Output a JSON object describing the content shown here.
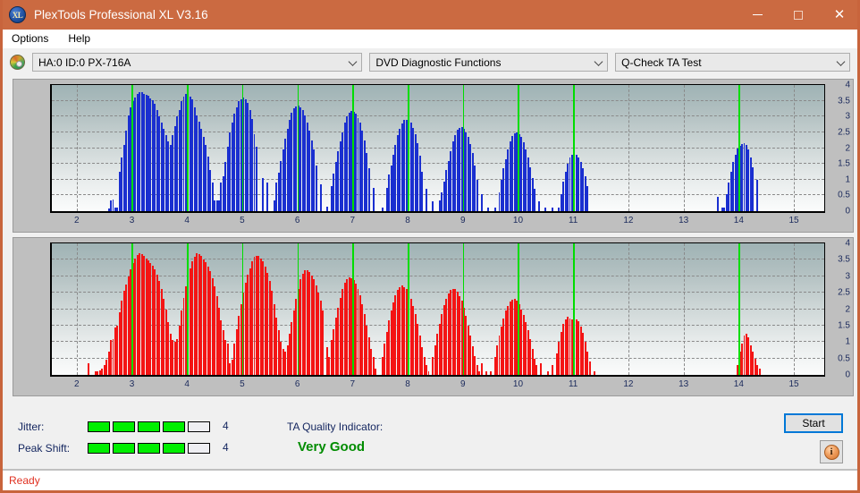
{
  "window": {
    "title": "PlexTools Professional XL V3.16",
    "app_icon": "XL",
    "minimize_label": "minimize",
    "maximize_label": "maximize",
    "close_label": "close"
  },
  "menubar": {
    "items": [
      {
        "label": "Options"
      },
      {
        "label": "Help"
      }
    ]
  },
  "toolbar": {
    "drive_icon": "disc-icon",
    "drive_select": "HA:0 ID:0  PX-716A",
    "function_select": "DVD Diagnostic Functions",
    "test_select": "Q-Check TA Test"
  },
  "stats": {
    "jitter_label": "Jitter:",
    "jitter_value": "4",
    "jitter_filled": 4,
    "jitter_total": 5,
    "peak_shift_label": "Peak Shift:",
    "peak_shift_value": "4",
    "peak_shift_filled": 4,
    "peak_shift_total": 5,
    "tqi_label": "TA Quality Indicator:",
    "tqi_value": "Very Good",
    "tqi_color": "#008c00",
    "start_label": "Start",
    "info_label": "i"
  },
  "statusbar": {
    "text": "Ready"
  },
  "colors": {
    "titlebar": "#cb6a41",
    "jitter_bar": "#00ef00",
    "marker_line": "#00dd00",
    "top_series": "#1a2fd0",
    "bottom_series": "#f41414",
    "status_text": "#e03020"
  },
  "chart_data": [
    {
      "type": "bar",
      "name": "jitter-histogram",
      "title": "",
      "xlabel": "",
      "ylabel": "",
      "color": "#1a2fd0",
      "xlim": [
        1.55,
        15.55
      ],
      "ylim": [
        0,
        4
      ],
      "yticks": [
        0,
        0.5,
        1,
        1.5,
        2,
        2.5,
        3,
        3.5,
        4
      ],
      "xticks": [
        2,
        3,
        4,
        5,
        6,
        7,
        8,
        9,
        10,
        11,
        12,
        13,
        14,
        15
      ],
      "grid": true,
      "markers": [
        3,
        4,
        5,
        6,
        7,
        8,
        9,
        10,
        11,
        14
      ],
      "x": [
        2.58,
        2.62,
        2.66,
        2.7,
        2.74,
        2.78,
        2.82,
        2.86,
        2.9,
        2.94,
        2.98,
        3.02,
        3.06,
        3.1,
        3.14,
        3.18,
        3.22,
        3.26,
        3.3,
        3.34,
        3.38,
        3.42,
        3.46,
        3.5,
        3.54,
        3.58,
        3.62,
        3.66,
        3.7,
        3.74,
        3.78,
        3.82,
        3.86,
        3.9,
        3.94,
        3.98,
        4.02,
        4.06,
        4.1,
        4.14,
        4.18,
        4.22,
        4.26,
        4.3,
        4.34,
        4.38,
        4.42,
        4.46,
        4.5,
        4.54,
        4.58,
        4.62,
        4.66,
        4.7,
        4.74,
        4.78,
        4.82,
        4.86,
        4.9,
        4.94,
        4.98,
        5.02,
        5.06,
        5.1,
        5.14,
        5.18,
        5.22,
        5.26,
        5.38,
        5.46,
        5.58,
        5.62,
        5.66,
        5.7,
        5.74,
        5.78,
        5.82,
        5.86,
        5.9,
        5.94,
        5.98,
        6.02,
        6.06,
        6.1,
        6.14,
        6.18,
        6.22,
        6.26,
        6.3,
        6.34,
        6.42,
        6.54,
        6.62,
        6.66,
        6.7,
        6.74,
        6.78,
        6.82,
        6.86,
        6.9,
        6.94,
        6.98,
        7.02,
        7.06,
        7.1,
        7.14,
        7.18,
        7.22,
        7.26,
        7.3,
        7.38,
        7.54,
        7.62,
        7.66,
        7.7,
        7.74,
        7.78,
        7.82,
        7.86,
        7.9,
        7.94,
        7.98,
        8.02,
        8.06,
        8.1,
        8.14,
        8.18,
        8.22,
        8.26,
        8.34,
        8.46,
        8.58,
        8.62,
        8.66,
        8.7,
        8.74,
        8.78,
        8.82,
        8.86,
        8.9,
        8.94,
        8.98,
        9.02,
        9.06,
        9.1,
        9.14,
        9.18,
        9.22,
        9.26,
        9.34,
        9.46,
        9.58,
        9.66,
        9.7,
        9.74,
        9.78,
        9.82,
        9.86,
        9.9,
        9.94,
        9.98,
        10.02,
        10.06,
        10.1,
        10.14,
        10.18,
        10.22,
        10.26,
        10.3,
        10.38,
        10.5,
        10.62,
        10.74,
        10.78,
        10.82,
        10.86,
        10.9,
        10.94,
        10.98,
        11.02,
        11.06,
        11.1,
        11.14,
        11.18,
        11.22,
        11.26,
        13.62,
        13.7,
        13.74,
        13.78,
        13.82,
        13.86,
        13.9,
        13.94,
        13.98,
        14.02,
        14.06,
        14.1,
        14.14,
        14.18,
        14.22,
        14.26,
        14.34
      ],
      "values": [
        0.08,
        0.35,
        0.36,
        0.1,
        0.1,
        1.25,
        1.7,
        2.1,
        2.55,
        3.05,
        3.3,
        3.48,
        3.6,
        3.72,
        3.78,
        3.78,
        3.72,
        3.7,
        3.65,
        3.58,
        3.52,
        3.4,
        3.22,
        3.0,
        2.8,
        2.62,
        2.4,
        2.2,
        2.1,
        2.42,
        2.7,
        3.0,
        3.2,
        3.48,
        3.62,
        3.72,
        3.7,
        3.62,
        3.55,
        3.3,
        3.05,
        2.85,
        2.6,
        2.35,
        2.1,
        1.72,
        1.3,
        0.92,
        0.33,
        0.33,
        0.35,
        0.9,
        1.1,
        1.55,
        2.05,
        2.5,
        2.8,
        3.1,
        3.3,
        3.48,
        3.55,
        3.6,
        3.56,
        3.42,
        3.2,
        2.92,
        2.45,
        2.05,
        1.05,
        0.9,
        0.33,
        0.9,
        1.22,
        1.6,
        1.95,
        2.3,
        2.6,
        2.9,
        3.12,
        3.25,
        3.32,
        3.35,
        3.3,
        3.2,
        3.05,
        2.8,
        2.55,
        2.25,
        1.95,
        1.45,
        0.85,
        0.15,
        0.8,
        1.2,
        1.55,
        1.9,
        2.22,
        2.5,
        2.8,
        3.0,
        3.12,
        3.18,
        3.15,
        3.1,
        2.95,
        2.8,
        2.55,
        2.25,
        1.85,
        1.35,
        0.75,
        0.12,
        0.75,
        1.15,
        1.45,
        1.8,
        2.1,
        2.4,
        2.6,
        2.78,
        2.88,
        2.9,
        2.88,
        2.8,
        2.65,
        2.45,
        2.15,
        1.75,
        1.25,
        0.7,
        0.3,
        0.35,
        0.6,
        0.95,
        1.3,
        1.6,
        1.9,
        2.2,
        2.42,
        2.58,
        2.65,
        2.66,
        2.6,
        2.5,
        2.35,
        2.12,
        1.85,
        1.45,
        1.0,
        0.55,
        0.12,
        0.12,
        0.6,
        1.0,
        1.35,
        1.65,
        1.95,
        2.2,
        2.38,
        2.48,
        2.5,
        2.45,
        2.35,
        2.18,
        1.95,
        1.7,
        1.4,
        1.05,
        0.7,
        0.3,
        0.1,
        0.1,
        0.12,
        0.55,
        0.95,
        1.25,
        1.5,
        1.7,
        1.8,
        1.82,
        1.78,
        1.7,
        1.55,
        1.35,
        1.1,
        0.8,
        0.45,
        0.12,
        0.12,
        0.55,
        0.9,
        1.25,
        1.55,
        1.8,
        1.98,
        2.08,
        2.12,
        2.15,
        2.1,
        1.95,
        1.7,
        1.38,
        1.0,
        0.6,
        0.12
      ]
    },
    {
      "type": "bar",
      "name": "peak-shift-histogram",
      "title": "",
      "xlabel": "",
      "ylabel": "",
      "color": "#f41414",
      "xlim": [
        1.55,
        15.55
      ],
      "ylim": [
        0,
        4
      ],
      "yticks": [
        0,
        0.5,
        1,
        1.5,
        2,
        2.5,
        3,
        3.5,
        4
      ],
      "xticks": [
        2,
        3,
        4,
        5,
        6,
        7,
        8,
        9,
        10,
        11,
        12,
        13,
        14,
        15
      ],
      "grid": true,
      "markers": [
        3,
        4,
        5,
        6,
        7,
        8,
        9,
        10,
        11,
        14
      ],
      "x": [
        2.22,
        2.34,
        2.38,
        2.42,
        2.46,
        2.5,
        2.54,
        2.58,
        2.62,
        2.66,
        2.7,
        2.74,
        2.78,
        2.82,
        2.86,
        2.9,
        2.94,
        2.98,
        3.02,
        3.06,
        3.1,
        3.14,
        3.18,
        3.22,
        3.26,
        3.3,
        3.34,
        3.38,
        3.42,
        3.46,
        3.5,
        3.54,
        3.58,
        3.62,
        3.66,
        3.7,
        3.74,
        3.78,
        3.82,
        3.86,
        3.9,
        3.94,
        3.98,
        4.02,
        4.06,
        4.1,
        4.14,
        4.18,
        4.22,
        4.26,
        4.3,
        4.34,
        4.38,
        4.42,
        4.46,
        4.5,
        4.54,
        4.58,
        4.62,
        4.66,
        4.7,
        4.74,
        4.78,
        4.82,
        4.86,
        4.9,
        4.94,
        4.98,
        5.02,
        5.06,
        5.1,
        5.14,
        5.18,
        5.22,
        5.26,
        5.3,
        5.34,
        5.38,
        5.42,
        5.46,
        5.5,
        5.54,
        5.58,
        5.62,
        5.66,
        5.7,
        5.74,
        5.78,
        5.82,
        5.86,
        5.9,
        5.94,
        5.98,
        6.02,
        6.06,
        6.1,
        6.14,
        6.18,
        6.22,
        6.26,
        6.3,
        6.34,
        6.38,
        6.42,
        6.46,
        6.54,
        6.58,
        6.62,
        6.66,
        6.7,
        6.74,
        6.78,
        6.82,
        6.86,
        6.9,
        6.94,
        6.98,
        7.02,
        7.06,
        7.1,
        7.14,
        7.18,
        7.22,
        7.26,
        7.3,
        7.34,
        7.38,
        7.42,
        7.54,
        7.58,
        7.62,
        7.66,
        7.7,
        7.74,
        7.78,
        7.82,
        7.86,
        7.9,
        7.94,
        7.98,
        8.02,
        8.06,
        8.1,
        8.14,
        8.18,
        8.22,
        8.26,
        8.3,
        8.34,
        8.38,
        8.46,
        8.5,
        8.54,
        8.58,
        8.62,
        8.66,
        8.7,
        8.74,
        8.78,
        8.82,
        8.86,
        8.9,
        8.94,
        8.98,
        9.02,
        9.06,
        9.1,
        9.14,
        9.18,
        9.22,
        9.26,
        9.3,
        9.34,
        9.42,
        9.5,
        9.58,
        9.62,
        9.66,
        9.7,
        9.74,
        9.78,
        9.82,
        9.86,
        9.9,
        9.94,
        9.98,
        10.02,
        10.06,
        10.1,
        10.14,
        10.18,
        10.22,
        10.26,
        10.3,
        10.34,
        10.42,
        10.54,
        10.62,
        10.7,
        10.74,
        10.78,
        10.82,
        10.86,
        10.9,
        10.94,
        10.98,
        11.02,
        11.06,
        11.1,
        11.14,
        11.18,
        11.22,
        11.26,
        11.3,
        11.38,
        13.98,
        14.02,
        14.06,
        14.1,
        14.14,
        14.18,
        14.22,
        14.26,
        14.3,
        14.34,
        14.38
      ],
      "values": [
        0.35,
        0.1,
        0.12,
        0.15,
        0.2,
        0.3,
        0.45,
        0.7,
        1.05,
        1.1,
        1.45,
        1.5,
        1.9,
        2.25,
        2.55,
        2.75,
        3.0,
        3.2,
        3.4,
        3.55,
        3.65,
        3.7,
        3.68,
        3.62,
        3.55,
        3.48,
        3.4,
        3.32,
        3.2,
        3.05,
        2.85,
        2.6,
        2.3,
        2.0,
        1.6,
        1.25,
        1.05,
        1.0,
        1.1,
        1.5,
        1.95,
        2.35,
        2.7,
        3.0,
        3.25,
        3.45,
        3.6,
        3.7,
        3.68,
        3.62,
        3.52,
        3.42,
        3.3,
        3.15,
        2.95,
        2.7,
        2.4,
        2.05,
        1.65,
        1.35,
        1.05,
        0.95,
        0.35,
        0.45,
        0.95,
        1.4,
        1.8,
        2.15,
        2.5,
        2.8,
        3.05,
        3.25,
        3.45,
        3.58,
        3.62,
        3.62,
        3.55,
        3.45,
        3.3,
        3.1,
        2.85,
        2.55,
        2.15,
        1.75,
        1.35,
        1.0,
        0.8,
        0.7,
        0.9,
        1.25,
        1.6,
        1.95,
        2.3,
        2.6,
        2.9,
        3.08,
        3.18,
        3.18,
        3.12,
        3.02,
        2.9,
        2.72,
        2.5,
        2.25,
        1.95,
        0.85,
        0.55,
        1.05,
        1.4,
        1.75,
        2.05,
        2.35,
        2.6,
        2.8,
        2.92,
        2.98,
        2.95,
        2.88,
        2.78,
        2.62,
        2.42,
        2.15,
        1.85,
        1.5,
        1.15,
        0.8,
        0.55,
        0.2,
        0.55,
        0.95,
        1.3,
        1.65,
        1.95,
        2.2,
        2.42,
        2.58,
        2.68,
        2.72,
        2.68,
        2.6,
        2.48,
        2.32,
        2.1,
        1.85,
        1.55,
        1.2,
        0.85,
        0.55,
        0.3,
        0.1,
        0.55,
        0.9,
        1.25,
        1.55,
        1.85,
        2.12,
        2.32,
        2.48,
        2.58,
        2.62,
        2.6,
        2.52,
        2.4,
        2.25,
        2.05,
        1.8,
        1.5,
        1.2,
        0.88,
        0.58,
        0.3,
        0.12,
        0.35,
        0.12,
        0.12,
        0.55,
        0.9,
        1.2,
        1.48,
        1.72,
        1.95,
        2.1,
        2.22,
        2.28,
        2.3,
        2.25,
        2.15,
        2.0,
        1.82,
        1.6,
        1.35,
        1.08,
        0.8,
        0.5,
        0.3,
        0.35,
        0.12,
        0.3,
        0.65,
        1.0,
        1.3,
        1.55,
        1.7,
        1.78,
        1.72,
        1.68,
        1.72,
        1.7,
        1.62,
        1.48,
        1.28,
        1.0,
        0.7,
        0.4,
        0.12,
        0.3,
        0.7,
        0.95,
        1.2,
        1.25,
        1.15,
        0.9,
        0.7,
        0.5,
        0.3,
        0.2
      ]
    }
  ]
}
